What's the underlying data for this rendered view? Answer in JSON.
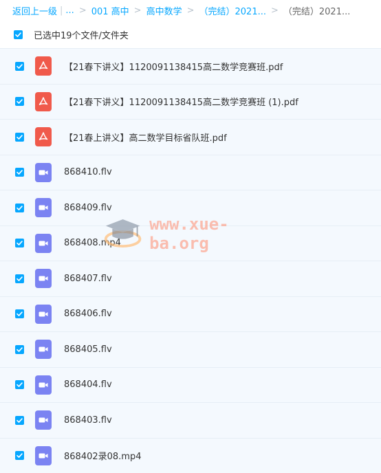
{
  "breadcrumb": {
    "back": "返回上一级",
    "bar": "|",
    "ellipsis": "...",
    "sep": ">",
    "items": [
      "001 高中",
      "高中数学",
      "（完结）2021..."
    ],
    "current": "（完结）2021..."
  },
  "selection": {
    "label": "已选中19个文件/文件夹",
    "checked": true
  },
  "files": [
    {
      "name": "【21春下讲义】1120091138415高二数学竞赛班.pdf",
      "type": "pdf",
      "checked": true
    },
    {
      "name": "【21春下讲义】1120091138415高二数学竞赛班 (1).pdf",
      "type": "pdf",
      "checked": true
    },
    {
      "name": "【21春上讲义】高二数学目标省队班.pdf",
      "type": "pdf",
      "checked": true
    },
    {
      "name": "868410.flv",
      "type": "video",
      "checked": true
    },
    {
      "name": "868409.flv",
      "type": "video",
      "checked": true
    },
    {
      "name": "868408.mp4",
      "type": "video",
      "checked": true
    },
    {
      "name": "868407.flv",
      "type": "video",
      "checked": true
    },
    {
      "name": "868406.flv",
      "type": "video",
      "checked": true
    },
    {
      "name": "868405.flv",
      "type": "video",
      "checked": true
    },
    {
      "name": "868404.flv",
      "type": "video",
      "checked": true
    },
    {
      "name": "868403.flv",
      "type": "video",
      "checked": true
    },
    {
      "name": "868402录08.mp4",
      "type": "video",
      "checked": true
    }
  ],
  "watermark": {
    "text": "www.xue-ba.org"
  },
  "colors": {
    "accent": "#06a7ff",
    "pdf": "#f05a4b",
    "video": "#7b83f2",
    "row_bg": "#f4f9fe"
  }
}
